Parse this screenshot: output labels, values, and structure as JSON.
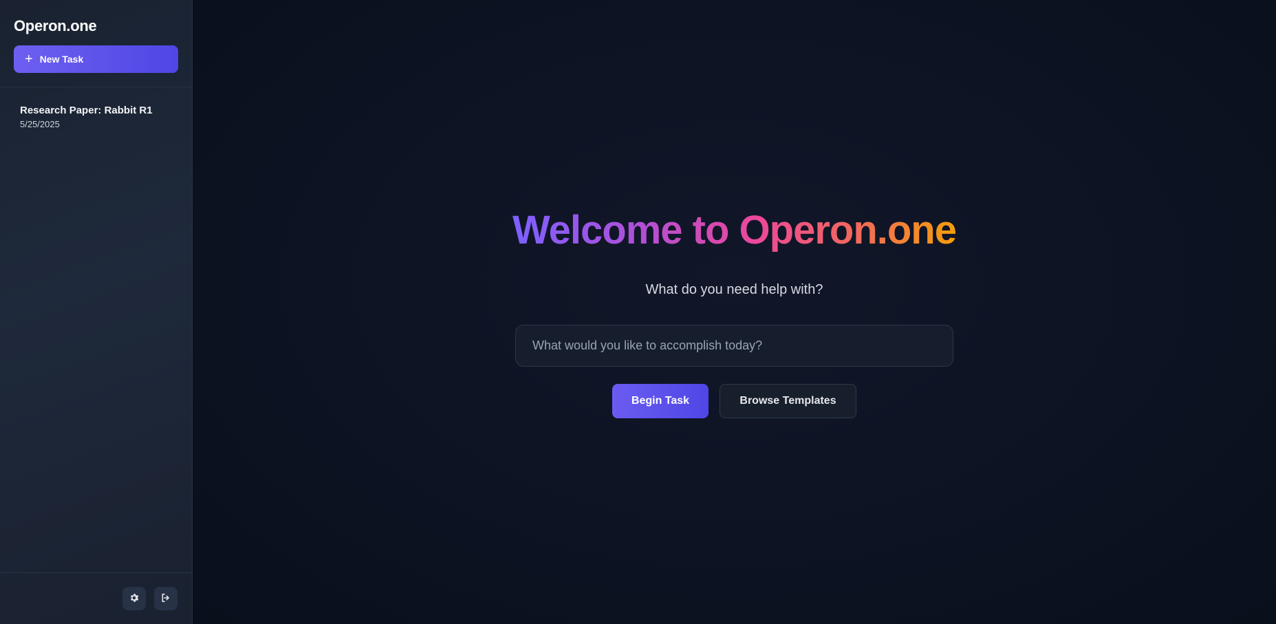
{
  "sidebar": {
    "brand": "Operon.one",
    "new_task_label": "New Task",
    "tasks": [
      {
        "title": "Research Paper: Rabbit R1",
        "date": "5/25/2025"
      }
    ],
    "footer_icons": [
      "gear-icon",
      "logout-icon"
    ]
  },
  "main": {
    "headline": "Welcome to Operon.one",
    "subtitle": "What do you need help with?",
    "prompt": {
      "placeholder": "What would you like to accomplish today?",
      "value": ""
    },
    "begin_label": "Begin Task",
    "browse_label": "Browse Templates"
  },
  "colors": {
    "accent": "#4f46e5",
    "gradient": [
      "#7b61ff",
      "#ec4899",
      "#f59e0b"
    ],
    "background": "#0b1020",
    "sidebar": "#1e293b"
  }
}
